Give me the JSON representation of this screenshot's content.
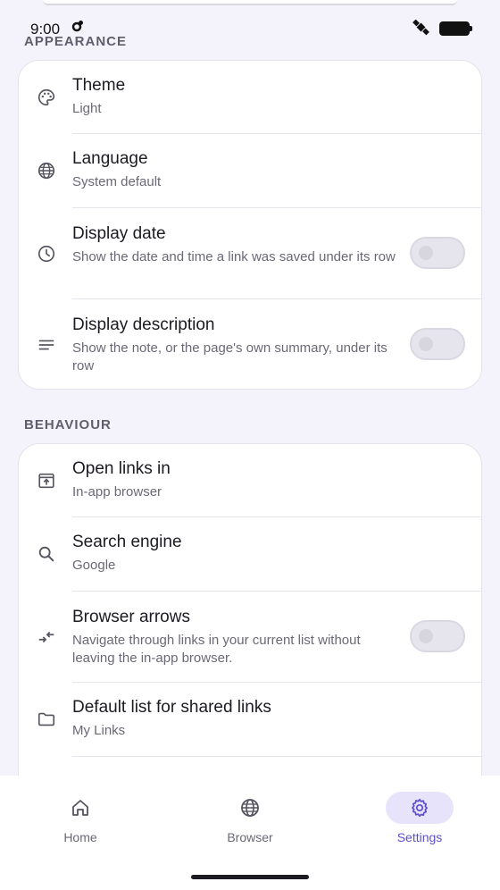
{
  "status_bar": {
    "time": "9:00",
    "left_icon": "gear-notification-icon",
    "right_icons": [
      "satellite-icon",
      "battery-icon"
    ]
  },
  "appearance": {
    "title": "APPEARANCE",
    "items": [
      {
        "icon": "palette-icon",
        "title": "Theme",
        "subtitle": "Light"
      },
      {
        "icon": "globe-icon",
        "title": "Language",
        "subtitle": "System default"
      },
      {
        "icon": "clock-icon",
        "title": "Display date",
        "subtitle": "Show the date and time a link was saved under its row",
        "toggle_on": false
      },
      {
        "icon": "lines-icon",
        "title": "Display description",
        "subtitle": "Show the note, or the page's own summary, under its row",
        "toggle_on": false
      }
    ]
  },
  "behaviour": {
    "title": "BEHAVIOUR",
    "items": [
      {
        "icon": "open-in-app-icon",
        "title": "Open links in",
        "subtitle": "In-app browser"
      },
      {
        "icon": "search-icon",
        "title": "Search engine",
        "subtitle": "Google"
      },
      {
        "icon": "arrows-icon",
        "title": "Browser arrows",
        "subtitle": "Navigate through links in your current list without leaving the in-app browser.",
        "toggle_on": false
      },
      {
        "icon": "folder-icon",
        "title": "Default list for shared links",
        "subtitle": "My Links"
      }
    ]
  },
  "bottom_nav": {
    "items": [
      {
        "icon": "home-icon",
        "label": "Home",
        "active": false
      },
      {
        "icon": "globe-icon",
        "label": "Browser",
        "active": false
      },
      {
        "icon": "gear-icon",
        "label": "Settings",
        "active": true
      }
    ]
  },
  "colors": {
    "background": "#F4F3FB",
    "card": "#FFFFFF",
    "accent": "#5B4FC9",
    "accent_container": "#E6E3FB",
    "text_secondary": "#6A6975"
  }
}
